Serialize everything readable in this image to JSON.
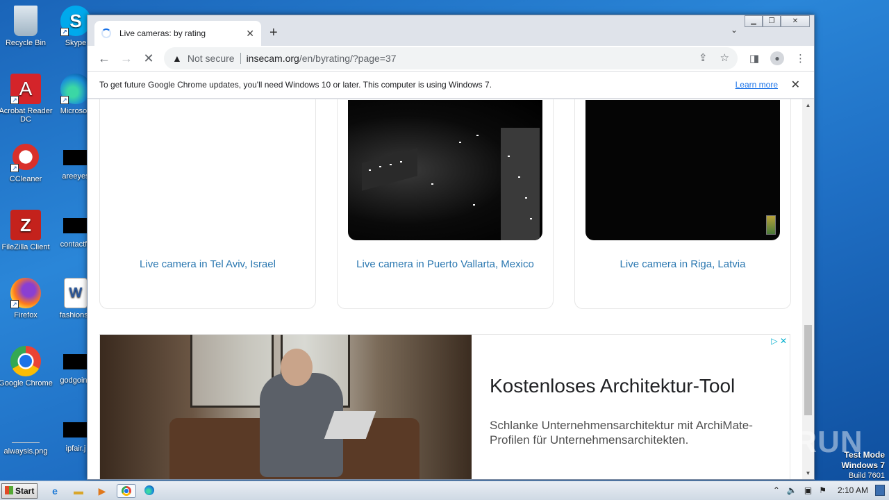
{
  "desktop": {
    "icons_left": [
      {
        "label": "Recycle Bin",
        "icon": "recycle-bin-icon"
      },
      {
        "label": "Acrobat Reader DC",
        "icon": "acrobat-icon"
      },
      {
        "label": "CCleaner",
        "icon": "ccleaner-icon"
      },
      {
        "label": "FileZilla Client",
        "icon": "filezilla-icon"
      },
      {
        "label": "Firefox",
        "icon": "firefox-icon"
      },
      {
        "label": "Google Chrome",
        "icon": "chrome-icon"
      },
      {
        "label": "alwaysis.png",
        "icon": "image-file-icon"
      }
    ],
    "icons_right": [
      {
        "label": "Skype",
        "icon": "skype-icon"
      },
      {
        "label": "Microsoft",
        "icon": "edge-icon"
      },
      {
        "label": "areeyes",
        "icon": "file-icon"
      },
      {
        "label": "contactfri",
        "icon": "file-icon"
      },
      {
        "label": "fashionsy",
        "icon": "word-icon"
      },
      {
        "label": "godgoing",
        "icon": "file-icon"
      },
      {
        "label": "ipfair.j",
        "icon": "file-icon"
      }
    ]
  },
  "browser": {
    "tab_title": "Live cameras: by rating",
    "tab_close": "✕",
    "new_tab": "+",
    "tab_list": "⌄",
    "url_warning": "Not secure",
    "url_host": "insecam.org",
    "url_path": "/en/byrating/?page=37",
    "infobar_text": "To get future Google Chrome updates, you'll need Windows 10 or later. This computer is using Windows 7.",
    "infobar_link": "Learn more",
    "infobar_close": "✕"
  },
  "cameras": [
    {
      "caption": "Live camera in Tel Aviv, Israel"
    },
    {
      "caption": "Live camera in Puerto Vallarta, Mexico"
    },
    {
      "caption": "Live camera in Riga, Latvia"
    }
  ],
  "ad": {
    "title": "Kostenloses Architektur-Tool",
    "description": "Schlanke Unternehmensarchitektur mit ArchiMate-Profilen für Unternehmensarchitekten.",
    "ad_choices": "▷ ✕"
  },
  "watermark": "ANY RUN",
  "test_mode": {
    "line1": "Test Mode",
    "line2": "Windows 7",
    "line3": "Build 7601"
  },
  "taskbar": {
    "start_label": "Start",
    "clock": "2:10 AM"
  }
}
